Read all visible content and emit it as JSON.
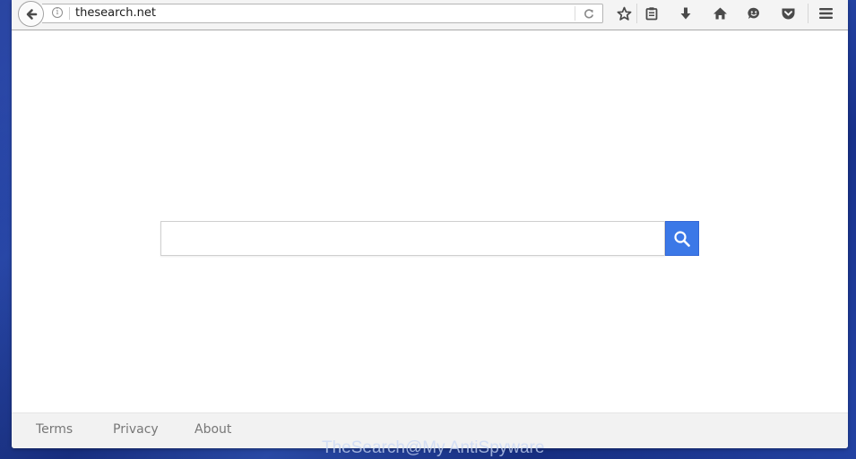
{
  "browser": {
    "url": "thesearch.net",
    "icons": {
      "back": "arrow-left-icon",
      "info": "info-icon",
      "reload": "reload-icon",
      "bookmark": "star-icon",
      "reading_list": "clipboard-icon",
      "downloads": "download-arrow-icon",
      "home": "home-icon",
      "hello": "chat-smile-icon",
      "pocket": "pocket-icon",
      "menu": "hamburger-menu-icon"
    },
    "info_glyph": "i"
  },
  "page": {
    "search": {
      "value": "",
      "placeholder": "",
      "button_icon": "search-icon",
      "accent_color": "#3b78e7"
    },
    "footer": {
      "links": [
        "Terms",
        "Privacy",
        "About"
      ]
    }
  },
  "watermark": "TheSearch@My AntiSpyware"
}
